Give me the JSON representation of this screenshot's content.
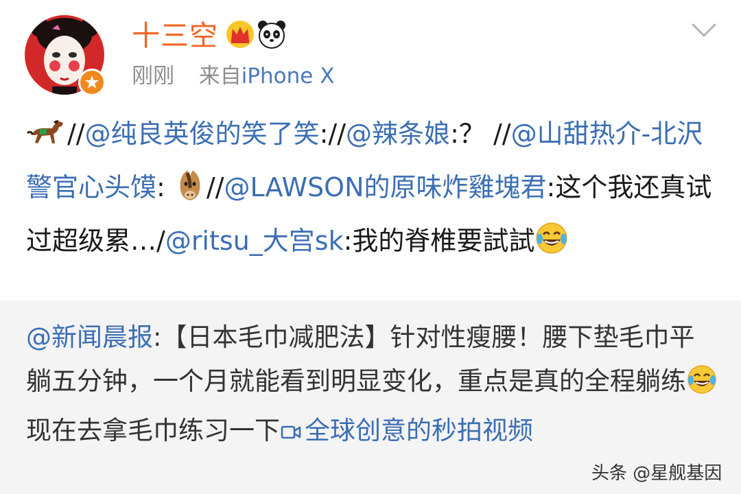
{
  "header": {
    "username": "十三空",
    "time": "刚刚",
    "source_prefix": "来自",
    "source": "iPhone X",
    "icons": [
      "crown-icon",
      "panda-icon",
      "verified-badge-icon",
      "chevron-down-icon"
    ]
  },
  "post": {
    "segments": [
      {
        "type": "emoji",
        "name": "running-horse-emoji"
      },
      {
        "type": "text",
        "text": "//"
      },
      {
        "type": "mention",
        "text": "@纯良英俊的笑了笑"
      },
      {
        "type": "text",
        "text": "://"
      },
      {
        "type": "mention",
        "text": "@辣条娘"
      },
      {
        "type": "text",
        "text": ":？ //"
      },
      {
        "type": "mention",
        "text": "@山甜热介-北沢警官心头馍"
      },
      {
        "type": "text",
        "text": ": "
      },
      {
        "type": "emoji",
        "name": "horse-face-emoji"
      },
      {
        "type": "text",
        "text": "//"
      },
      {
        "type": "mention",
        "text": "@LAWSON的原味炸雞塊君"
      },
      {
        "type": "text",
        "text": ":这个我还真试过超级累…/"
      },
      {
        "type": "mention",
        "text": "@ritsu_大宫sk"
      },
      {
        "type": "text",
        "text": ":我的脊椎要試試"
      },
      {
        "type": "emoji",
        "name": "laughing-tears-emoji"
      }
    ]
  },
  "repost": {
    "mention": "@新闻晨报",
    "text_1": ":【日本毛巾减肥法】针对性瘦腰！腰下垫毛巾平躺五分钟，一个月就能看到明显变化，重点是真的全程躺练",
    "text_2": " 现在去拿毛巾练习一下",
    "video_link": "全球创意的秒拍视频"
  },
  "watermark": "头条 @星舰基因",
  "colors": {
    "username": "#f26522",
    "link": "#3b6eb3",
    "meta": "#8e8e8e",
    "repost_bg": "#f4f4f4"
  }
}
